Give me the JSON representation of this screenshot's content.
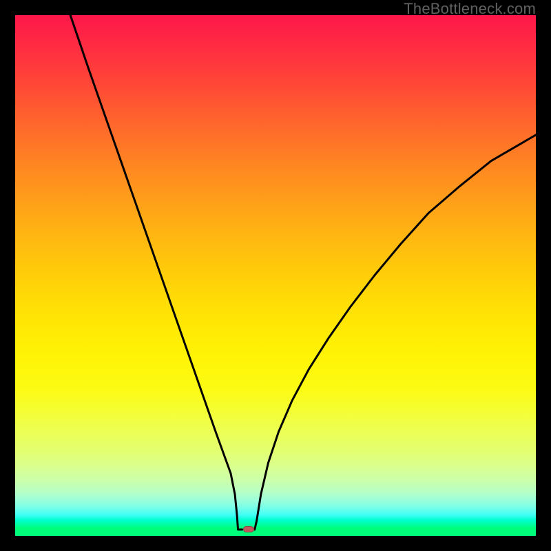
{
  "watermark": "TheBottleneck.com",
  "colors": {
    "curve_stroke": "#000000",
    "cap_fill": "#c1595e"
  },
  "chart_data": {
    "type": "line",
    "title": "",
    "xlabel": "",
    "ylabel": "",
    "xlim": [
      0,
      100
    ],
    "ylim": [
      0,
      100
    ],
    "grid": false,
    "legend": null,
    "curve_left": {
      "description": "steep descending branch from upper-left down to floor near x≈43",
      "points": [
        {
          "x": 10.6,
          "y": 100
        },
        {
          "x": 14,
          "y": 90
        },
        {
          "x": 17.5,
          "y": 80
        },
        {
          "x": 21,
          "y": 70
        },
        {
          "x": 24.5,
          "y": 60
        },
        {
          "x": 28,
          "y": 50
        },
        {
          "x": 31.5,
          "y": 40
        },
        {
          "x": 35,
          "y": 30
        },
        {
          "x": 38.5,
          "y": 20
        },
        {
          "x": 41.4,
          "y": 12
        },
        {
          "x": 42.2,
          "y": 8
        },
        {
          "x": 42.6,
          "y": 4
        },
        {
          "x": 42.8,
          "y": 1.2
        },
        {
          "x": 43.6,
          "y": 1.2
        }
      ]
    },
    "curve_right": {
      "description": "rising branch from floor near x≈46, concave (sqrt-like), exiting right edge near y≈77",
      "points": [
        {
          "x": 46.0,
          "y": 1.2
        },
        {
          "x": 46.4,
          "y": 3
        },
        {
          "x": 47.2,
          "y": 8
        },
        {
          "x": 48.6,
          "y": 14
        },
        {
          "x": 50.6,
          "y": 20
        },
        {
          "x": 53.2,
          "y": 26
        },
        {
          "x": 56.4,
          "y": 32
        },
        {
          "x": 60.2,
          "y": 38
        },
        {
          "x": 64.4,
          "y": 44
        },
        {
          "x": 69.0,
          "y": 50
        },
        {
          "x": 74.0,
          "y": 56
        },
        {
          "x": 79.4,
          "y": 62
        },
        {
          "x": 85.2,
          "y": 67
        },
        {
          "x": 91.4,
          "y": 72
        },
        {
          "x": 100,
          "y": 77
        }
      ]
    },
    "cap": {
      "x": 44.8,
      "y": 1.2
    }
  }
}
